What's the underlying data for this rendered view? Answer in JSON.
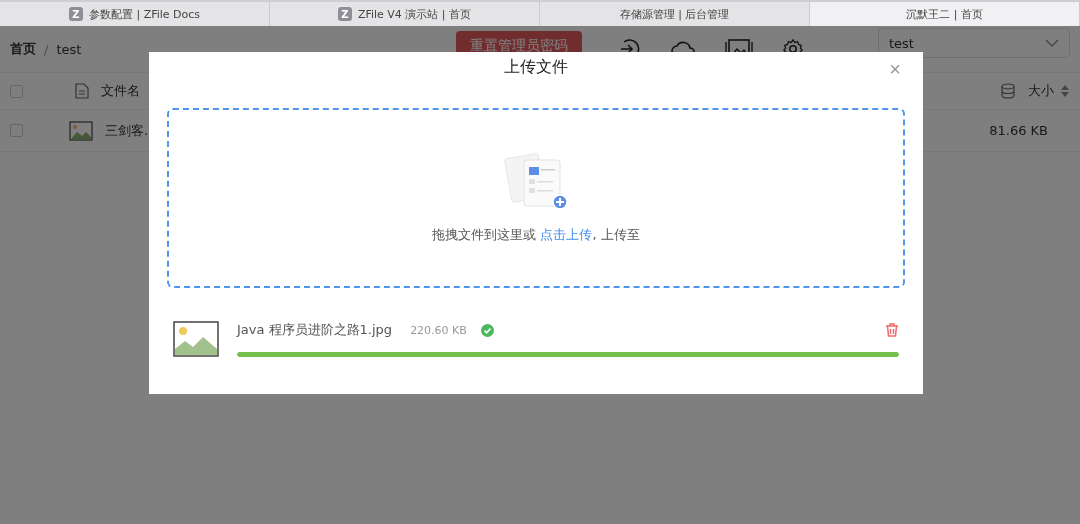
{
  "browser_tabs": [
    {
      "label": "参数配置 | ZFile Docs",
      "favicon": "Z",
      "selected": false
    },
    {
      "label": "ZFile V4 演示站 | 首页",
      "favicon": "Z",
      "selected": false
    },
    {
      "label": "存储源管理 | 后台管理",
      "selected": false
    },
    {
      "label": "沉默王二 | 首页",
      "selected": true
    }
  ],
  "breadcrumb": {
    "items": [
      "首页",
      "test"
    ],
    "separator": "/"
  },
  "reset_button": "重置管理员密码",
  "storage_select": {
    "value": "test"
  },
  "table": {
    "all_checked": false,
    "columns": [
      "文件名",
      "大小"
    ],
    "rows": [
      {
        "name": "三剑客.",
        "size": "81.66 KB",
        "checked": false
      }
    ]
  },
  "dialog": {
    "title": "上传文件",
    "close": "×",
    "dropzone": {
      "before": "拖拽文件到这里或 ",
      "link": "点击上传",
      "after": ", 上传至"
    },
    "files": [
      {
        "name": "Java 程序员进阶之路1.jpg",
        "size": "220.60 KB",
        "done": true,
        "level": 1
      }
    ]
  }
}
